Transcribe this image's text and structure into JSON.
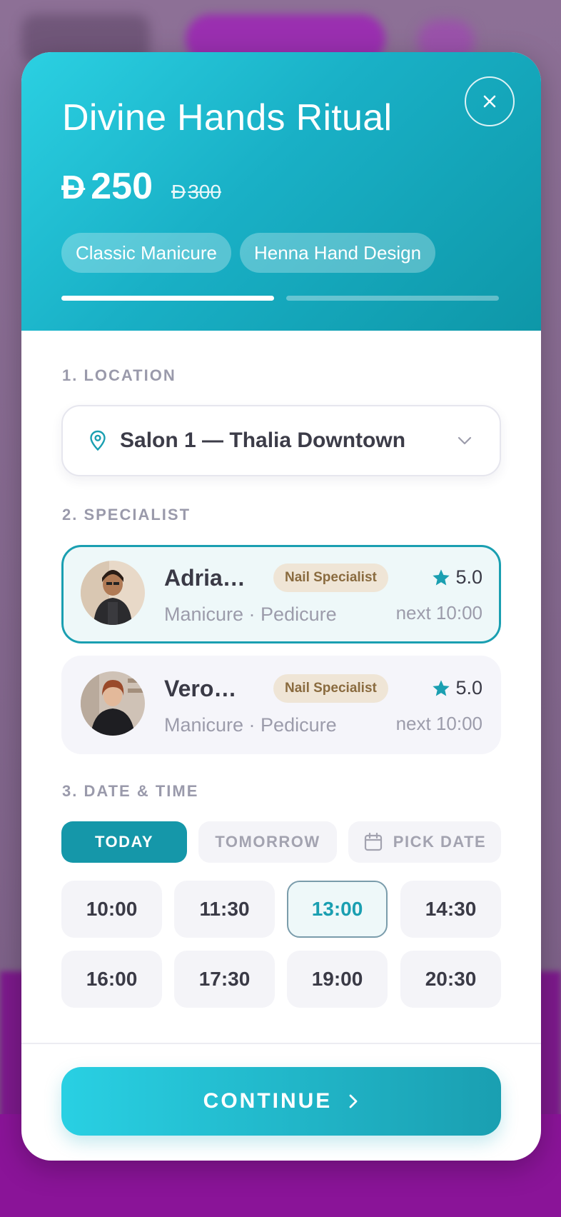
{
  "modal": {
    "title": "Divine Hands Ritual",
    "price": {
      "currency": "Đ",
      "amount": "250",
      "old_currency": "Đ",
      "old_amount": "300"
    },
    "services": [
      "Classic Manicure",
      "Henna Hand Design"
    ],
    "progress": {
      "steps": 2,
      "current_step": 1
    }
  },
  "location": {
    "label": "1. LOCATION",
    "value": "Salon 1 — Thalia Downtown"
  },
  "specialist": {
    "label": "2. SPECIALIST",
    "items": [
      {
        "name": "Adria…",
        "badge": "Nail Specialist",
        "services": "Manicure · Pedicure",
        "rating": "5.0",
        "next": "next 10:00",
        "selected": true
      },
      {
        "name": "Vero…",
        "badge": "Nail Specialist",
        "services": "Manicure · Pedicure",
        "rating": "5.0",
        "next": "next 10:00",
        "selected": false
      }
    ]
  },
  "datetime": {
    "label": "3. DATE & TIME",
    "tabs": [
      "TODAY",
      "TOMORROW",
      "PICK DATE"
    ],
    "active_tab": "TODAY",
    "slots": [
      "10:00",
      "11:30",
      "13:00",
      "14:30",
      "16:00",
      "17:30",
      "19:00",
      "20:30"
    ],
    "selected_slot": "13:00"
  },
  "footer": {
    "continue_label": "CONTINUE"
  },
  "colors": {
    "accent": "#1a9fb1",
    "accent_light": "#29d0e3",
    "badge_bg": "#efe5d6"
  },
  "icons": {
    "close": "close-icon",
    "location": "map-pin-icon",
    "dropdown": "chevron-down-icon",
    "star": "star-icon",
    "calendar": "calendar-icon",
    "continue": "chevron-right-icon"
  }
}
